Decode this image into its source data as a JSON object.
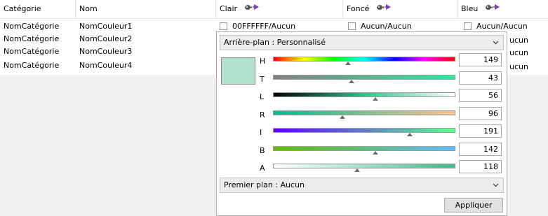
{
  "columns": {
    "category": "Catégorie",
    "name": "Nom",
    "light": "Clair",
    "dark": "Foncé",
    "blue": "Bleu"
  },
  "header_icon": "color-edit-icon",
  "rows": [
    {
      "category": "NomCatégorie",
      "name": "NomCouleur1",
      "light": "00FFFFFF/Aucun",
      "dark": "Aucun/Aucun",
      "blue": "Aucun/Aucun"
    },
    {
      "category": "NomCatégorie",
      "name": "NomCouleur2",
      "blue_partial": "ucun"
    },
    {
      "category": "NomCatégorie",
      "name": "NomCouleur3",
      "blue_partial": "ucun"
    },
    {
      "category": "NomCatégorie",
      "name": "NomCouleur4",
      "blue_partial": "ucun"
    }
  ],
  "editor": {
    "background_combo": "Arrière-plan : Personnalisé",
    "foreground_combo": "Premier plan : Aucun",
    "apply_label": "Appliquer",
    "preview_color": "#b3e2cc",
    "sliders": [
      {
        "label": "H",
        "value": "149",
        "fraction": 0.41,
        "gradient": "linear-gradient(to right,#ff0000,#ffff00,#00ff00,#00ffff,#0000ff,#ff00ff,#ff0000)"
      },
      {
        "label": "T",
        "value": "43",
        "fraction": 0.43,
        "gradient": "linear-gradient(to right,#808080,#2ee89a)"
      },
      {
        "label": "L",
        "value": "56",
        "fraction": 0.56,
        "gradient": "linear-gradient(to right,#000000,#34c088,#ffffff)"
      },
      {
        "label": "R",
        "value": "96",
        "fraction": 0.38,
        "gradient": "linear-gradient(to right,#00be8e,#ffbe8e)"
      },
      {
        "label": "I",
        "value": "191",
        "fraction": 0.75,
        "gradient": "linear-gradient(to right,#6000ff,#60ff8e)"
      },
      {
        "label": "B",
        "value": "142",
        "fraction": 0.56,
        "gradient": "linear-gradient(to right,#60be00,#60beff)"
      },
      {
        "label": "A",
        "value": "118",
        "fraction": 0.46,
        "gradient": "linear-gradient(to right,#ffffff,#3dbc8c)"
      }
    ]
  }
}
